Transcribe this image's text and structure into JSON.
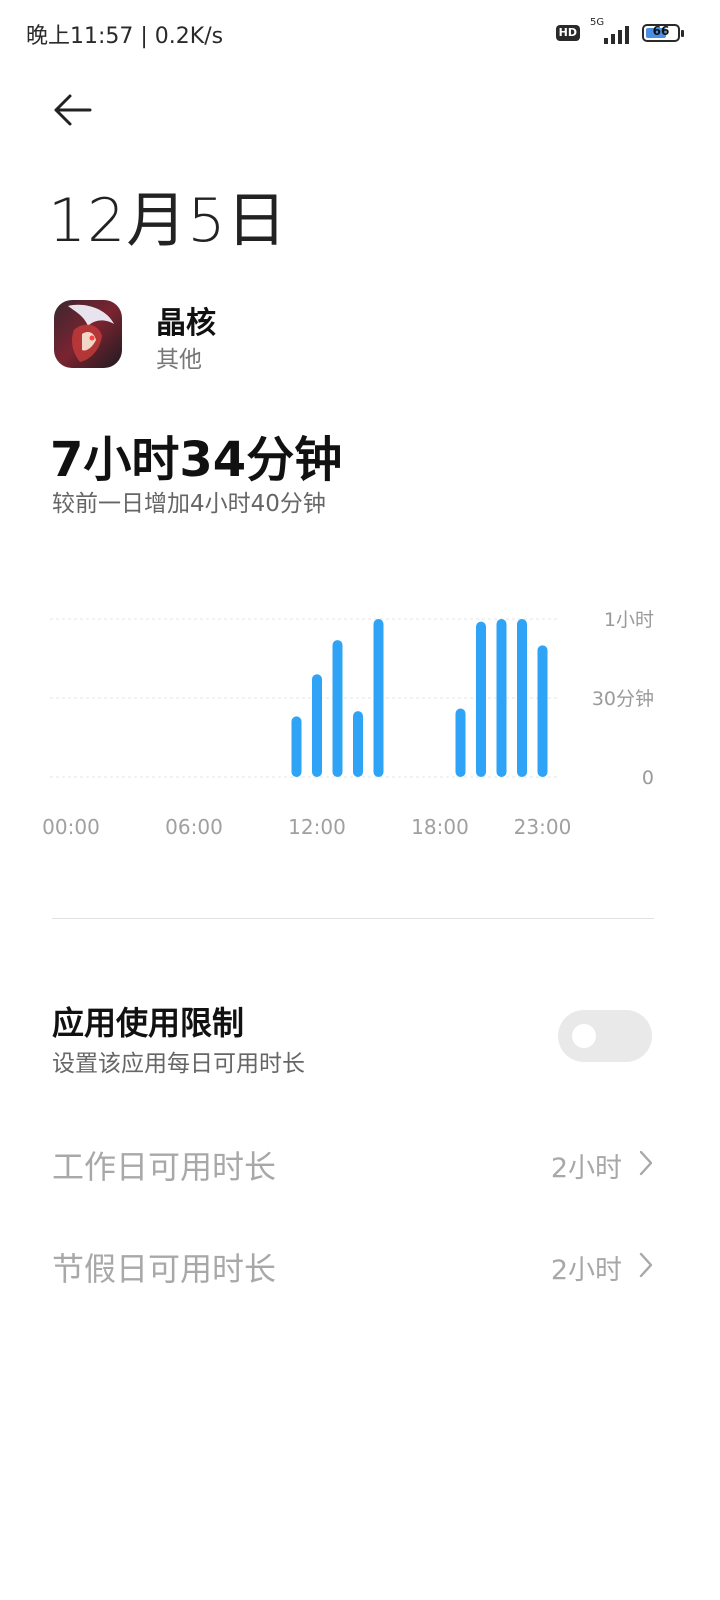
{
  "status_bar": {
    "time_speed": "晚上11:57 | 0.2K/s",
    "hd_badge": "HD",
    "network": "5G",
    "battery_level": "66",
    "battery_fraction": 0.66,
    "icons": [
      "hd-icon",
      "signal-5g-icon",
      "battery-icon"
    ]
  },
  "header": {
    "back_icon": "arrow-left-icon",
    "date": "12月5日"
  },
  "app": {
    "name": "晶核",
    "category": "其他",
    "icon": "app-icon-crystal-core"
  },
  "usage": {
    "total": "7小时34分钟",
    "compare": "较前一日增加4小时40分钟"
  },
  "chart_data": {
    "type": "bar",
    "x": [
      "00:00",
      "01:00",
      "02:00",
      "03:00",
      "04:00",
      "05:00",
      "06:00",
      "07:00",
      "08:00",
      "09:00",
      "10:00",
      "11:00",
      "12:00",
      "13:00",
      "14:00",
      "15:00",
      "16:00",
      "17:00",
      "18:00",
      "19:00",
      "20:00",
      "21:00",
      "22:00",
      "23:00"
    ],
    "values": [
      0,
      0,
      0,
      0,
      0,
      0,
      0,
      0,
      0,
      0,
      0,
      23,
      39,
      52,
      25,
      60,
      0,
      0,
      0,
      26,
      59,
      60,
      60,
      50
    ],
    "x_tick_labels": [
      "00:00",
      "06:00",
      "12:00",
      "18:00",
      "23:00"
    ],
    "y_tick_labels": [
      "1小时",
      "30分钟",
      "0"
    ],
    "ylim": [
      0,
      60
    ],
    "unit": "minutes",
    "color": "#2fa3f6",
    "grid": true,
    "y_axis_side": "right"
  },
  "limits": {
    "title": "应用使用限制",
    "subtitle": "设置该应用每日可用时长",
    "enabled": false,
    "workday_label": "工作日可用时长",
    "workday_value": "2小时",
    "holiday_label": "节假日可用时长",
    "holiday_value": "2小时",
    "chevron_icon": "chevron-right-icon"
  }
}
